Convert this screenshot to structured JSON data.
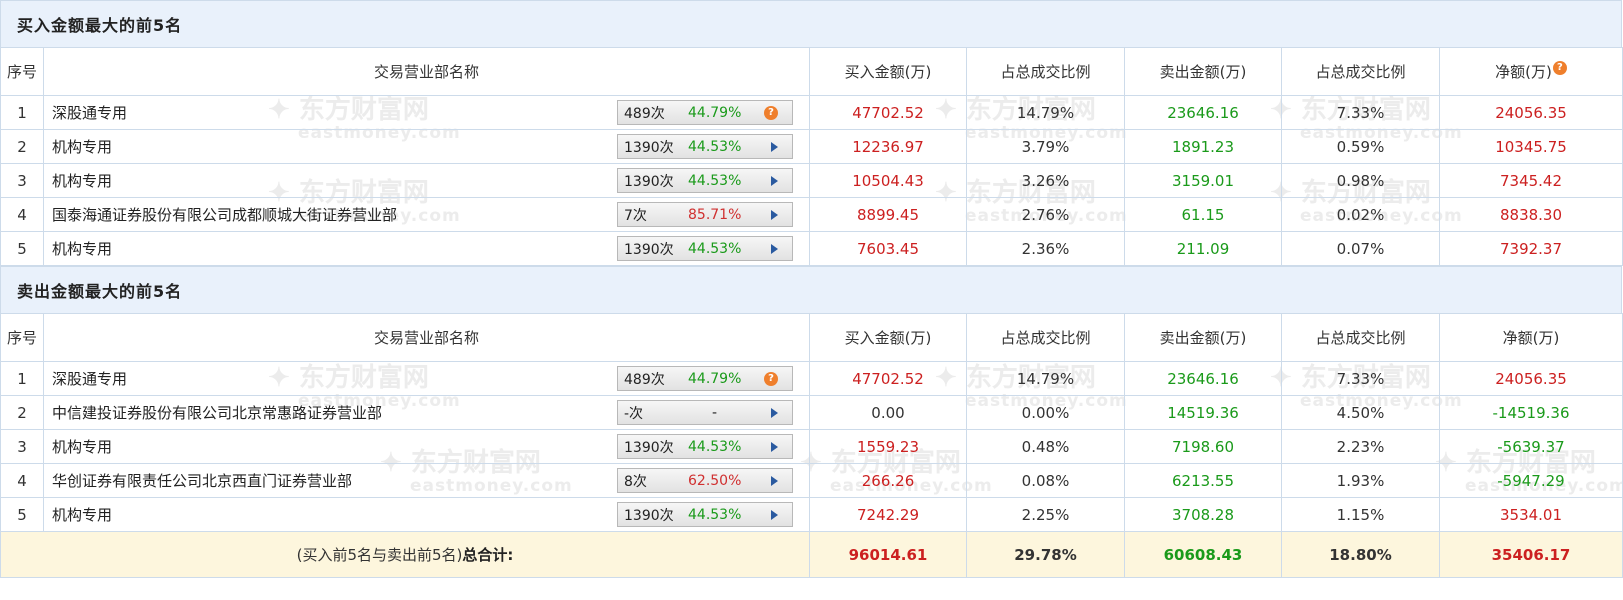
{
  "watermark": {
    "brand": "东方财富网",
    "domain": "eastmoney.com"
  },
  "buy_section": {
    "title": "买入金额最大的前5名",
    "headers": [
      "序号",
      "交易营业部名称",
      "买入金额(万)",
      "占总成交比例",
      "卖出金额(万)",
      "占总成交比例",
      "净额(万)"
    ],
    "rows": [
      {
        "idx": "1",
        "name": "深股通专用",
        "count": "489次",
        "pct": "44.79%",
        "pct_color": "green",
        "icon": "question-icon",
        "buy": "47702.52",
        "buy_ratio": "14.79%",
        "sell": "23646.16",
        "sell_ratio": "7.33%",
        "net": "24056.35",
        "net_color": "red"
      },
      {
        "idx": "2",
        "name": "机构专用",
        "count": "1390次",
        "pct": "44.53%",
        "pct_color": "green",
        "icon": "arrow-right-icon",
        "buy": "12236.97",
        "buy_ratio": "3.79%",
        "sell": "1891.23",
        "sell_ratio": "0.59%",
        "net": "10345.75",
        "net_color": "red"
      },
      {
        "idx": "3",
        "name": "机构专用",
        "count": "1390次",
        "pct": "44.53%",
        "pct_color": "green",
        "icon": "arrow-right-icon",
        "buy": "10504.43",
        "buy_ratio": "3.26%",
        "sell": "3159.01",
        "sell_ratio": "0.98%",
        "net": "7345.42",
        "net_color": "red"
      },
      {
        "idx": "4",
        "name": "国泰海通证券股份有限公司成都顺城大街证券营业部",
        "count": "7次",
        "pct": "85.71%",
        "pct_color": "red",
        "icon": "arrow-right-icon",
        "buy": "8899.45",
        "buy_ratio": "2.76%",
        "sell": "61.15",
        "sell_ratio": "0.02%",
        "net": "8838.30",
        "net_color": "red"
      },
      {
        "idx": "5",
        "name": "机构专用",
        "count": "1390次",
        "pct": "44.53%",
        "pct_color": "green",
        "icon": "arrow-right-icon",
        "buy": "7603.45",
        "buy_ratio": "2.36%",
        "sell": "211.09",
        "sell_ratio": "0.07%",
        "net": "7392.37",
        "net_color": "red"
      }
    ]
  },
  "sell_section": {
    "title": "卖出金额最大的前5名",
    "headers": [
      "序号",
      "交易营业部名称",
      "买入金额(万)",
      "占总成交比例",
      "卖出金额(万)",
      "占总成交比例",
      "净额(万)"
    ],
    "rows": [
      {
        "idx": "1",
        "name": "深股通专用",
        "count": "489次",
        "pct": "44.79%",
        "pct_color": "green",
        "icon": "question-icon",
        "buy": "47702.52",
        "buy_ratio": "14.79%",
        "sell": "23646.16",
        "sell_ratio": "7.33%",
        "net": "24056.35",
        "net_color": "red",
        "buy_color": "red"
      },
      {
        "idx": "2",
        "name": "中信建投证券股份有限公司北京常惠路证券营业部",
        "count": "-次",
        "pct": "-",
        "pct_color": "neutral",
        "icon": "arrow-right-icon",
        "buy": "0.00",
        "buy_ratio": "0.00%",
        "sell": "14519.36",
        "sell_ratio": "4.50%",
        "net": "-14519.36",
        "net_color": "green",
        "buy_color": "neutral"
      },
      {
        "idx": "3",
        "name": "机构专用",
        "count": "1390次",
        "pct": "44.53%",
        "pct_color": "green",
        "icon": "arrow-right-icon",
        "buy": "1559.23",
        "buy_ratio": "0.48%",
        "sell": "7198.60",
        "sell_ratio": "2.23%",
        "net": "-5639.37",
        "net_color": "green",
        "buy_color": "red"
      },
      {
        "idx": "4",
        "name": "华创证券有限责任公司北京西直门证券营业部",
        "count": "8次",
        "pct": "62.50%",
        "pct_color": "red",
        "icon": "arrow-right-icon",
        "buy": "266.26",
        "buy_ratio": "0.08%",
        "sell": "6213.55",
        "sell_ratio": "1.93%",
        "net": "-5947.29",
        "net_color": "green",
        "buy_color": "red"
      },
      {
        "idx": "5",
        "name": "机构专用",
        "count": "1390次",
        "pct": "44.53%",
        "pct_color": "green",
        "icon": "arrow-right-icon",
        "buy": "7242.29",
        "buy_ratio": "2.25%",
        "sell": "3708.28",
        "sell_ratio": "1.15%",
        "net": "3534.01",
        "net_color": "red",
        "buy_color": "red"
      }
    ],
    "total": {
      "label_prefix": "(买入前5名与卖出前5名)",
      "label_bold": "总合计:",
      "buy": "96014.61",
      "buy_ratio": "29.78%",
      "sell": "60608.43",
      "sell_ratio": "18.80%",
      "net": "35406.17"
    }
  },
  "colors": {
    "red": "#cc2020",
    "green": "#1a9a1a",
    "header_bg": "#e9f1fb",
    "total_bg": "#fdf6dd",
    "border": "#cddbea"
  }
}
